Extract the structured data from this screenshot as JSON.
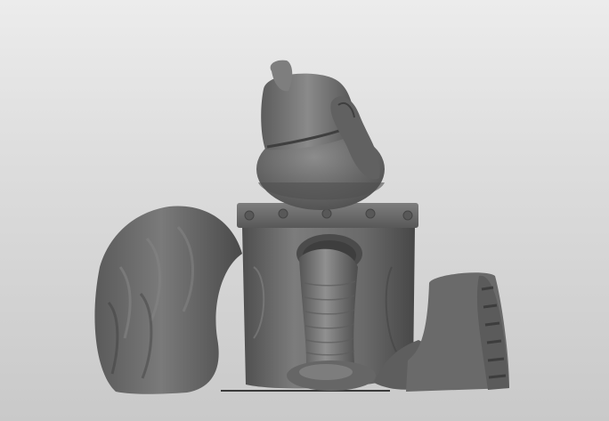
{
  "scene": {
    "background_top": "#ececec",
    "background_bottom": "#c9c9c9",
    "model_color": "#6f6f6f"
  }
}
